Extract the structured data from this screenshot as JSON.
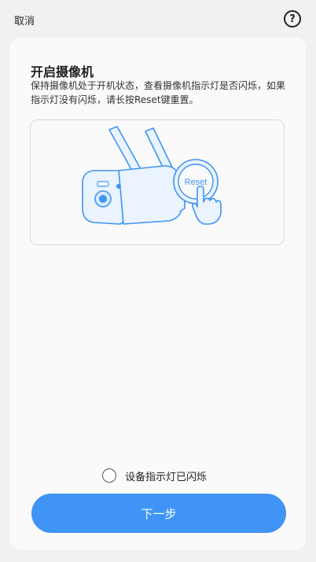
{
  "header": {
    "cancel_label": "取消",
    "help_icon": "question-circle-icon"
  },
  "main": {
    "title": "开启摄像机",
    "description": "保持摄像机处于开机状态，查看摄像机指示灯是否闪烁，如果指示灯没有闪烁，请长按Reset键重置。",
    "illustration": {
      "reset_label": "Reset",
      "accent": "#3f94f6"
    },
    "confirm_label": "设备指示灯已闪烁",
    "confirm_checked": false,
    "next_button_label": "下一步"
  }
}
